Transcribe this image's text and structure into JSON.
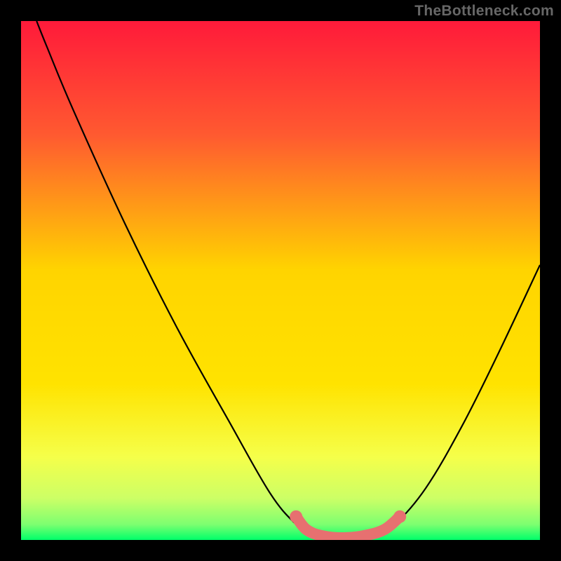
{
  "watermark": "TheBottleneck.com",
  "chart_data": {
    "type": "line",
    "title": "",
    "xlabel": "",
    "ylabel": "",
    "xlim": [
      0,
      100
    ],
    "ylim": [
      0,
      100
    ],
    "gradient": {
      "top": "#ff1a3a",
      "upper_mid": "#ff6a2a",
      "mid": "#ffd400",
      "lower_mid": "#f5ff4a",
      "lower": "#d8ff6a",
      "bottom": "#00ff6a"
    },
    "series": [
      {
        "name": "curve",
        "type": "line",
        "color": "#000000",
        "points": [
          {
            "x": 3,
            "y": 100
          },
          {
            "x": 5,
            "y": 95
          },
          {
            "x": 10,
            "y": 83
          },
          {
            "x": 20,
            "y": 61
          },
          {
            "x": 30,
            "y": 41
          },
          {
            "x": 40,
            "y": 23
          },
          {
            "x": 48,
            "y": 9
          },
          {
            "x": 53,
            "y": 3
          },
          {
            "x": 56,
            "y": 1
          },
          {
            "x": 62,
            "y": 0.3
          },
          {
            "x": 68,
            "y": 1
          },
          {
            "x": 72,
            "y": 3
          },
          {
            "x": 78,
            "y": 10
          },
          {
            "x": 85,
            "y": 22
          },
          {
            "x": 92,
            "y": 36
          },
          {
            "x": 100,
            "y": 53
          }
        ]
      },
      {
        "name": "overlay-band",
        "type": "line",
        "color": "#e77070",
        "points": [
          {
            "x": 53,
            "y": 4.5
          },
          {
            "x": 55,
            "y": 2
          },
          {
            "x": 58,
            "y": 0.8
          },
          {
            "x": 62,
            "y": 0.4
          },
          {
            "x": 66,
            "y": 0.8
          },
          {
            "x": 70,
            "y": 2
          },
          {
            "x": 73,
            "y": 4.5
          }
        ]
      }
    ]
  }
}
